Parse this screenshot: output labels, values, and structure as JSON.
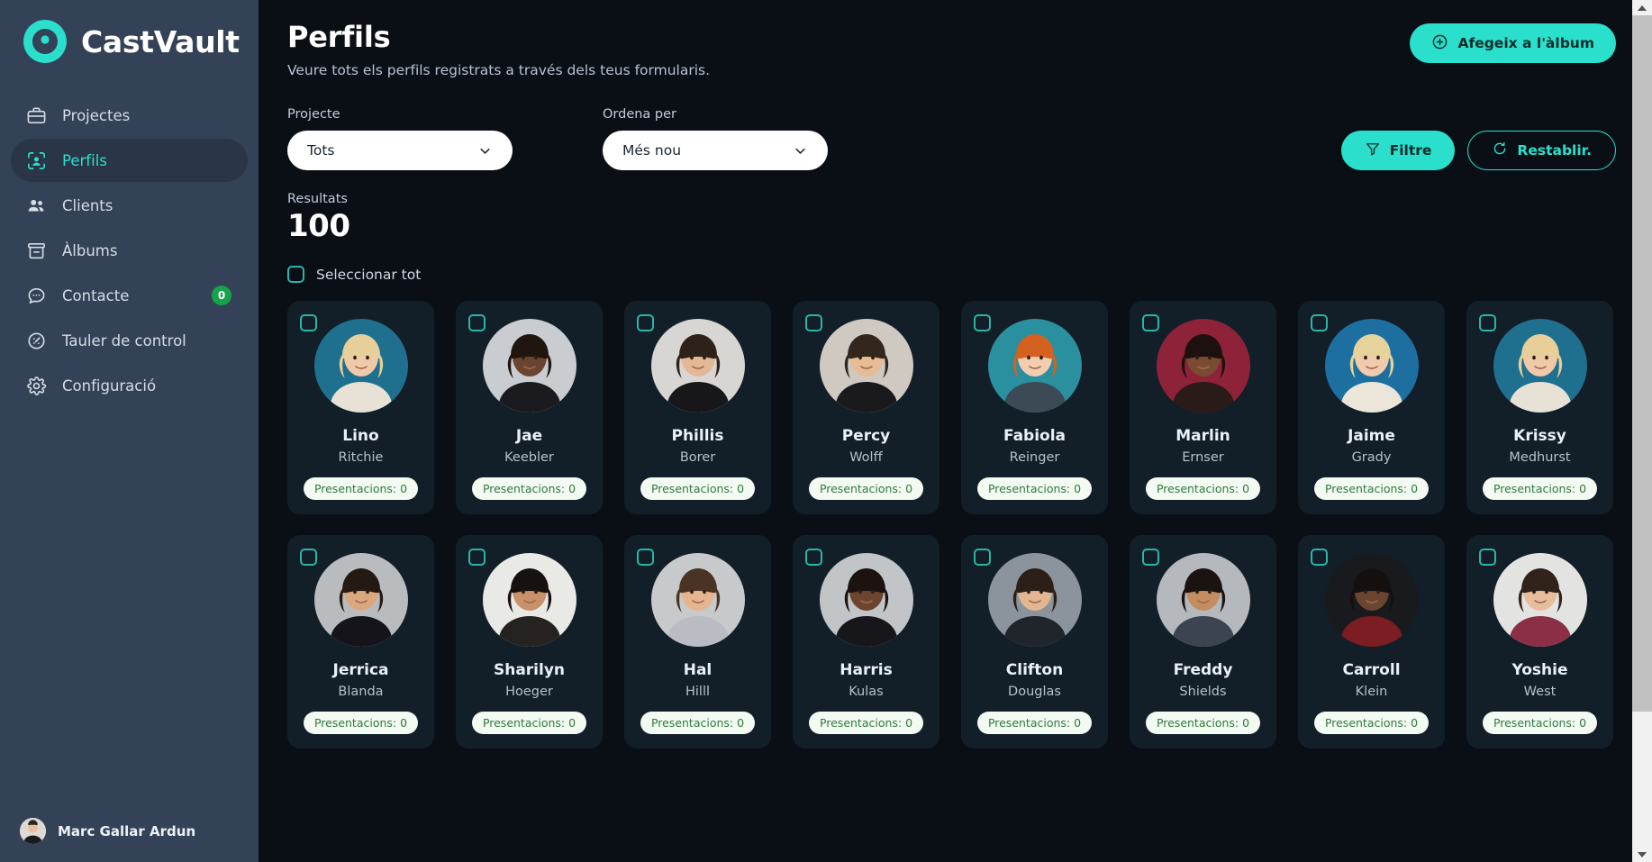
{
  "brand": {
    "name": "CastVault",
    "logo_icon": "aperture-logo-icon"
  },
  "sidebar": {
    "items": [
      {
        "label": "Projectes",
        "icon": "briefcase-icon",
        "active": false,
        "badge": null
      },
      {
        "label": "Perfils",
        "icon": "scan-person-icon",
        "active": true,
        "badge": null
      },
      {
        "label": "Clients",
        "icon": "users-icon",
        "active": false,
        "badge": null
      },
      {
        "label": "Àlbums",
        "icon": "archive-box-icon",
        "active": false,
        "badge": null
      },
      {
        "label": "Contacte",
        "icon": "chat-bubble-icon",
        "active": false,
        "badge": "0"
      },
      {
        "label": "Tauler de control",
        "icon": "gauge-icon",
        "active": false,
        "badge": null
      },
      {
        "label": "Configuració",
        "icon": "gear-icon",
        "active": false,
        "badge": null
      }
    ],
    "user": {
      "name": "Marc Gallar Ardun",
      "avatar_icon": "user-avatar"
    }
  },
  "header": {
    "title": "Perfils",
    "subtitle": "Veure tots els perfils registrats a través dels teus formularis.",
    "add_to_album_label": "Afegeix a l'àlbum",
    "add_to_album_icon": "plus-circle-icon"
  },
  "filters": {
    "project_label": "Projecte",
    "project_value": "Tots",
    "project_options": [
      "Tots"
    ],
    "sort_label": "Ordena per",
    "sort_value": "Més nou",
    "sort_options": [
      "Més nou"
    ],
    "filter_button_label": "Filtre",
    "filter_button_icon": "funnel-icon",
    "reset_button_label": "Restablir.",
    "reset_button_icon": "refresh-icon",
    "chevron_icon": "chevron-down-icon"
  },
  "results": {
    "label": "Resultats",
    "count": "100"
  },
  "select_all": {
    "label": "Seleccionar tot",
    "checked": false
  },
  "profiles": [
    {
      "first": "Lino",
      "last": "Ritchie",
      "badge": "Presentacions: 0",
      "checked": false,
      "avatar": {
        "bg": "#1f6f8e",
        "skin": "#f0c9a8",
        "hair": "#e8cf9a",
        "shirt": "#e8e2d6"
      }
    },
    {
      "first": "Jae",
      "last": "Keebler",
      "badge": "Presentacions: 0",
      "checked": false,
      "avatar": {
        "bg": "#c9cdd1",
        "skin": "#6b4430",
        "hair": "#20160f",
        "shirt": "#1b1b1f"
      }
    },
    {
      "first": "Phillis",
      "last": "Borer",
      "badge": "Presentacions: 0",
      "checked": false,
      "avatar": {
        "bg": "#d8d6d2",
        "skin": "#e4b894",
        "hair": "#2e2119",
        "shirt": "#17171a"
      }
    },
    {
      "first": "Percy",
      "last": "Wolff",
      "badge": "Presentacions: 0",
      "checked": false,
      "avatar": {
        "bg": "#cfc9c2",
        "skin": "#e6bb96",
        "hair": "#33261c",
        "shirt": "#1a1a1d"
      }
    },
    {
      "first": "Fabiola",
      "last": "Reinger",
      "badge": "Presentacions: 0",
      "checked": false,
      "avatar": {
        "bg": "#2a8f9e",
        "skin": "#f2cdb0",
        "hair": "#d4611f",
        "shirt": "#3c4a55"
      }
    },
    {
      "first": "Marlin",
      "last": "Ernser",
      "badge": "Presentacions: 0",
      "checked": false,
      "avatar": {
        "bg": "#8e2238",
        "skin": "#7a4b31",
        "hair": "#1d1110",
        "shirt": "#2a1b18"
      }
    },
    {
      "first": "Jaime",
      "last": "Grady",
      "badge": "Presentacions: 0",
      "checked": false,
      "avatar": {
        "bg": "#1d6fa0",
        "skin": "#f1cbab",
        "hair": "#e6d39b",
        "shirt": "#ece6da"
      }
    },
    {
      "first": "Krissy",
      "last": "Medhurst",
      "badge": "Presentacions: 0",
      "checked": false,
      "avatar": {
        "bg": "#1f6f8e",
        "skin": "#f0c9a8",
        "hair": "#e8cf9a",
        "shirt": "#e8e2d6"
      }
    },
    {
      "first": "Jerrica",
      "last": "Blanda",
      "badge": "Presentacions: 0",
      "checked": false,
      "avatar": {
        "bg": "#b9bcbe",
        "skin": "#dba87e",
        "hair": "#241a13",
        "shirt": "#14141a"
      }
    },
    {
      "first": "Sharilyn",
      "last": "Hoeger",
      "badge": "Presentacions: 0",
      "checked": false,
      "avatar": {
        "bg": "#e9e9e6",
        "skin": "#c99169",
        "hair": "#171210",
        "shirt": "#262220"
      }
    },
    {
      "first": "Hal",
      "last": "Hilll",
      "badge": "Presentacions: 0",
      "checked": false,
      "avatar": {
        "bg": "#c7c9cb",
        "skin": "#e6b58f",
        "hair": "#4a3324",
        "shirt": "#b9bcc2"
      }
    },
    {
      "first": "Harris",
      "last": "Kulas",
      "badge": "Presentacions: 0",
      "checked": false,
      "avatar": {
        "bg": "#c2c5c8",
        "skin": "#6d452f",
        "hair": "#1c1310",
        "shirt": "#17171b"
      }
    },
    {
      "first": "Clifton",
      "last": "Douglas",
      "badge": "Presentacions: 0",
      "checked": false,
      "avatar": {
        "bg": "#8b949c",
        "skin": "#e3b590",
        "hair": "#2b1f17",
        "shirt": "#20242b"
      }
    },
    {
      "first": "Freddy",
      "last": "Shields",
      "badge": "Presentacions: 0",
      "checked": false,
      "avatar": {
        "bg": "#b5b9bd",
        "skin": "#c48d5f",
        "hair": "#1a1310",
        "shirt": "#3b4450"
      }
    },
    {
      "first": "Carroll",
      "last": "Klein",
      "badge": "Presentacions: 0",
      "checked": false,
      "avatar": {
        "bg": "#191a1d",
        "skin": "#6a452f",
        "hair": "#151010",
        "shirt": "#7b1d22"
      }
    },
    {
      "first": "Yoshie",
      "last": "West",
      "badge": "Presentacions: 0",
      "checked": false,
      "avatar": {
        "bg": "#e3e4e2",
        "skin": "#e8bd9b",
        "hair": "#32231a",
        "shirt": "#8b2f46"
      }
    }
  ],
  "scrollbar": {
    "up_icon": "triangle-up-icon",
    "down_icon": "triangle-down-icon"
  },
  "colors": {
    "accent": "#2ae0cc",
    "sidebar_bg": "#344258",
    "main_bg": "#0a0f16",
    "card_bg": "#121f29",
    "badge_green": "#16a34a",
    "pill_text": "#2f7a3e"
  }
}
